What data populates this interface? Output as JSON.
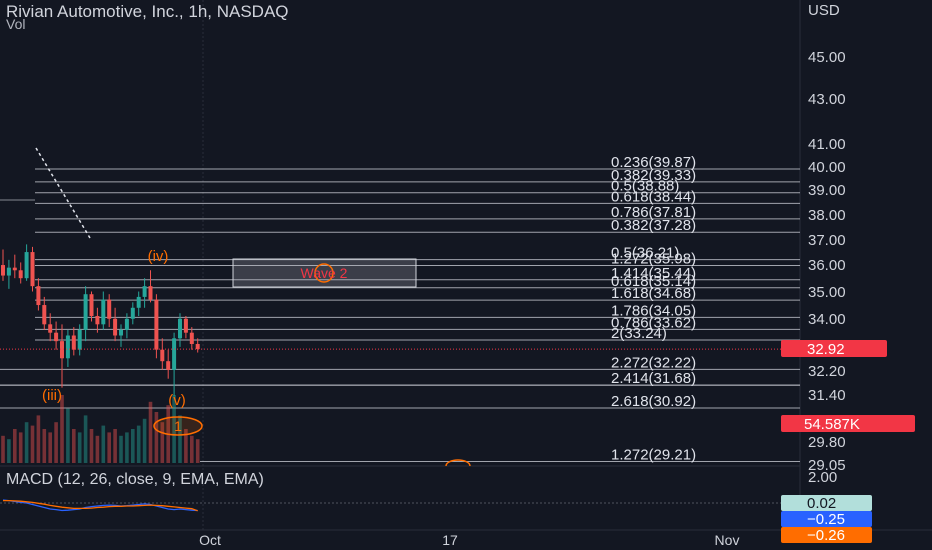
{
  "header": {
    "title": "Rivian Automotive, Inc., 1h, NASDAQ",
    "volume_label": "Vol",
    "currency": "USD",
    "macd_label": "MACD (12, 26, close, 9, EMA, EMA)"
  },
  "colors": {
    "background": "#131722",
    "up": "#26a69a",
    "down": "#ef5350",
    "fib_line": "#d1d4dc",
    "wave_label": "#ff6d00",
    "price_badge": "#f23645",
    "macd_line": "#2962ff",
    "signal_line": "#ff6d00"
  },
  "chart_data": {
    "type": "candlestick",
    "symbol": "Rivian Automotive, Inc.",
    "interval": "1h",
    "exchange": "NASDAQ",
    "x_ticks": [
      "Oct",
      "17",
      "Nov"
    ],
    "y_ticks": [
      "45.00",
      "43.00",
      "41.00",
      "40.00",
      "39.00",
      "38.00",
      "37.00",
      "36.00",
      "35.00",
      "34.00",
      "32.20",
      "31.40",
      "29.80",
      "29.05"
    ],
    "price_scale": "log",
    "last_price": "32.92",
    "volume_value": "54.587K",
    "macd_values": [
      "0.02",
      "−0.25",
      "−0.26"
    ],
    "macd_top_tick": "2.00",
    "fib_levels": [
      {
        "label": "0.236(39.87)",
        "price": 39.87
      },
      {
        "label": "0.382(39.33)",
        "price": 39.33
      },
      {
        "label": "0.5(38.88)",
        "price": 38.88
      },
      {
        "label": "0.618(38.44)",
        "price": 38.44
      },
      {
        "label": "0.786(37.81)",
        "price": 37.81
      },
      {
        "label": "0.382(37.28)",
        "price": 37.28
      },
      {
        "label": "0.5(36.21)",
        "price": 36.21
      },
      {
        "label": "1.272(35.98)",
        "price": 35.98
      },
      {
        "label": "1.414(35.44)",
        "price": 35.44
      },
      {
        "label": "0.618(35.14)",
        "price": 35.14
      },
      {
        "label": "1.618(34.68)",
        "price": 34.68
      },
      {
        "label": "1.786(34.05)",
        "price": 34.05
      },
      {
        "label": "0.786(33.62)",
        "price": 33.62
      },
      {
        "label": "2(33.24)",
        "price": 33.24
      },
      {
        "label": "2.272(32.22)",
        "price": 32.22
      },
      {
        "label": "2.414(31.68)",
        "price": 31.68
      },
      {
        "label": "2.618(30.92)",
        "price": 30.92
      },
      {
        "label": "1.272(29.21)",
        "price": 29.21
      }
    ],
    "wave_labels": [
      "(iv)",
      "(iii)",
      "(v)",
      "1",
      "Wave 2"
    ],
    "candles": [
      [
        36.0,
        36.6,
        35.4,
        35.6
      ],
      [
        35.6,
        36.2,
        35.1,
        35.9
      ],
      [
        35.9,
        36.4,
        35.5,
        35.8
      ],
      [
        35.8,
        36.1,
        35.3,
        35.5
      ],
      [
        35.5,
        36.8,
        35.4,
        36.5
      ],
      [
        36.5,
        36.7,
        35.0,
        35.2
      ],
      [
        35.2,
        35.5,
        34.3,
        34.5
      ],
      [
        34.5,
        34.8,
        33.6,
        33.8
      ],
      [
        33.8,
        34.2,
        33.2,
        33.5
      ],
      [
        33.5,
        33.9,
        32.9,
        33.2
      ],
      [
        33.2,
        33.8,
        31.6,
        32.6
      ],
      [
        32.6,
        33.6,
        32.3,
        33.4
      ],
      [
        33.4,
        33.7,
        32.7,
        32.9
      ],
      [
        32.9,
        33.8,
        32.7,
        33.6
      ],
      [
        33.6,
        35.2,
        33.2,
        34.9
      ],
      [
        34.9,
        35.0,
        33.9,
        34.1
      ],
      [
        34.1,
        34.4,
        33.5,
        33.8
      ],
      [
        33.8,
        35.0,
        33.6,
        34.7
      ],
      [
        34.7,
        34.9,
        33.7,
        34.0
      ],
      [
        34.0,
        34.4,
        33.2,
        33.4
      ],
      [
        33.4,
        33.8,
        33.0,
        33.6
      ],
      [
        33.6,
        34.2,
        33.3,
        34.0
      ],
      [
        34.0,
        34.6,
        33.8,
        34.4
      ],
      [
        34.4,
        35.0,
        34.1,
        34.8
      ],
      [
        34.8,
        35.5,
        34.4,
        35.2
      ],
      [
        35.2,
        35.8,
        34.6,
        34.7
      ],
      [
        34.7,
        34.9,
        32.6,
        32.9
      ],
      [
        32.9,
        33.3,
        32.2,
        32.5
      ],
      [
        32.5,
        32.9,
        31.9,
        32.2
      ],
      [
        32.2,
        33.5,
        31.3,
        33.3
      ],
      [
        33.3,
        34.2,
        33.0,
        34.0
      ],
      [
        34.0,
        34.1,
        33.3,
        33.5
      ],
      [
        33.5,
        33.7,
        32.9,
        33.1
      ],
      [
        33.1,
        33.3,
        32.8,
        32.92
      ]
    ],
    "volumes": [
      0.4,
      0.35,
      0.5,
      0.45,
      0.6,
      0.55,
      0.7,
      0.5,
      0.45,
      0.6,
      1.0,
      0.8,
      0.5,
      0.45,
      0.7,
      0.5,
      0.4,
      0.55,
      0.45,
      0.5,
      0.4,
      0.45,
      0.5,
      0.55,
      0.65,
      0.9,
      0.75,
      0.6,
      0.85,
      1.0,
      0.7,
      0.5,
      0.4,
      0.35
    ],
    "macd_line": [
      0.1,
      0.08,
      0.05,
      0.02,
      0.0,
      -0.05,
      -0.1,
      -0.15,
      -0.2,
      -0.22,
      -0.25,
      -0.24,
      -0.22,
      -0.2,
      -0.15,
      -0.12,
      -0.1,
      -0.08,
      -0.07,
      -0.08,
      -0.1,
      -0.09,
      -0.07,
      -0.05,
      -0.03,
      -0.05,
      -0.1,
      -0.15,
      -0.2,
      -0.22,
      -0.2,
      -0.22,
      -0.24,
      -0.25
    ],
    "signal_line": [
      0.08,
      0.08,
      0.07,
      0.06,
      0.04,
      0.02,
      -0.01,
      -0.04,
      -0.08,
      -0.11,
      -0.14,
      -0.16,
      -0.18,
      -0.18,
      -0.18,
      -0.17,
      -0.15,
      -0.14,
      -0.12,
      -0.11,
      -0.11,
      -0.1,
      -0.1,
      -0.09,
      -0.08,
      -0.07,
      -0.08,
      -0.09,
      -0.11,
      -0.13,
      -0.15,
      -0.17,
      -0.19,
      -0.26
    ]
  }
}
